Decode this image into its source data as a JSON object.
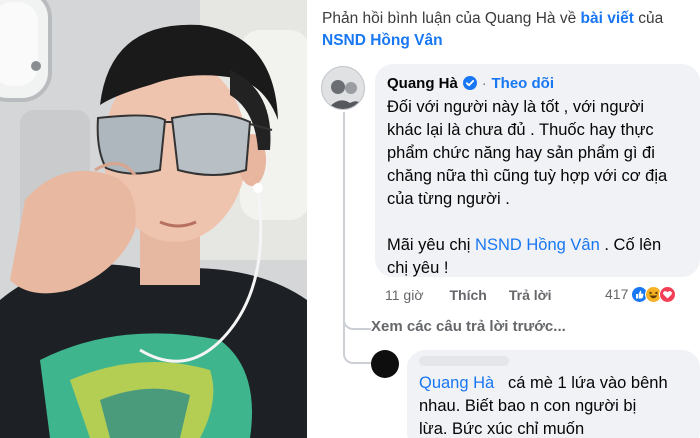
{
  "header": {
    "prefix": "Phản hồi bình luận của Quang Hà về",
    "post_link": "bài viết",
    "of": "của",
    "page_name": "NSND Hồng Vân"
  },
  "comment": {
    "author": "Quang Hà",
    "separator": "·",
    "follow_label": "Theo dõi",
    "lines": [
      "Đối với người này là tốt , với người",
      "khác lại là chưa đủ . Thuốc hay thực",
      "phẩm chức năng hay sản phẩm gì đi",
      "chăng nữa thì cũng tuỳ hợp với cơ địa",
      "của từng người ."
    ],
    "closing_prefix": "Mãi yêu chị",
    "closing_mention": "NSND Hồng Vân",
    "closing_suffix": ". Cố lên",
    "closing_line2": "chị yêu !",
    "time": "11 giờ",
    "like_label": "Thích",
    "reply_label": "Trả lời",
    "reaction_count": "417",
    "reactions": [
      "like-icon",
      "haha-icon",
      "love-icon"
    ]
  },
  "view_previous": "Xem các câu trả lời trước...",
  "reply": {
    "mention": "Quang Hà",
    "text_line1": "cá mè 1 lứa vào bênh",
    "text_line2": "nhau. Biết bao n con người bị",
    "text_line3": "lừa. Bức xúc chỉ muốn"
  },
  "colors": {
    "link": "#1877f2",
    "bubble": "#f0f2f5",
    "secondary_text": "#65676b"
  }
}
